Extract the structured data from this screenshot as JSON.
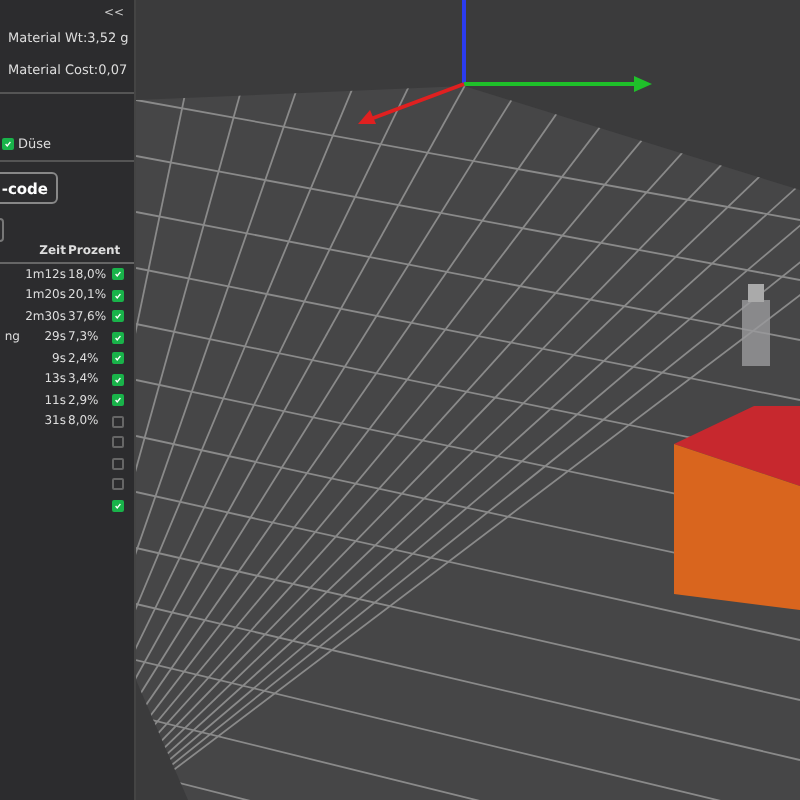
{
  "panel": {
    "collapse": "<<",
    "material_weight": "Material Wt:3,52 g",
    "material_cost": "Material Cost:0,07",
    "nozzle_option": {
      "label": "Düse",
      "checked": true
    },
    "gcode_button": "-code",
    "table": {
      "columns": [
        "Zeit",
        "Prozent"
      ],
      "rows": [
        {
          "column_1": "",
          "time": "1m12s",
          "percent": "18,0%",
          "checked": true
        },
        {
          "column_1": "",
          "time": "1m20s",
          "percent": "20,1%",
          "checked": true
        },
        {
          "column_1": "",
          "time": "2m30s",
          "percent": "37,6%",
          "checked": true
        },
        {
          "column_1": "ng",
          "time": "29s",
          "percent": "7,3%",
          "checked": true
        },
        {
          "column_1": "",
          "time": "9s",
          "percent": "2,4%",
          "checked": true
        },
        {
          "column_1": "",
          "time": "13s",
          "percent": "3,4%",
          "checked": true
        },
        {
          "column_1": "",
          "time": "11s",
          "percent": "2,9%",
          "checked": true
        },
        {
          "column_1": "",
          "time": "31s",
          "percent": "8,0%",
          "checked": false
        },
        {
          "column_1": "",
          "time": "",
          "percent": "",
          "checked": false
        },
        {
          "column_1": "",
          "time": "",
          "percent": "",
          "checked": false
        },
        {
          "column_1": "",
          "time": "",
          "percent": "",
          "checked": false
        },
        {
          "column_1": "",
          "time": "",
          "percent": "",
          "checked": true
        }
      ]
    }
  }
}
